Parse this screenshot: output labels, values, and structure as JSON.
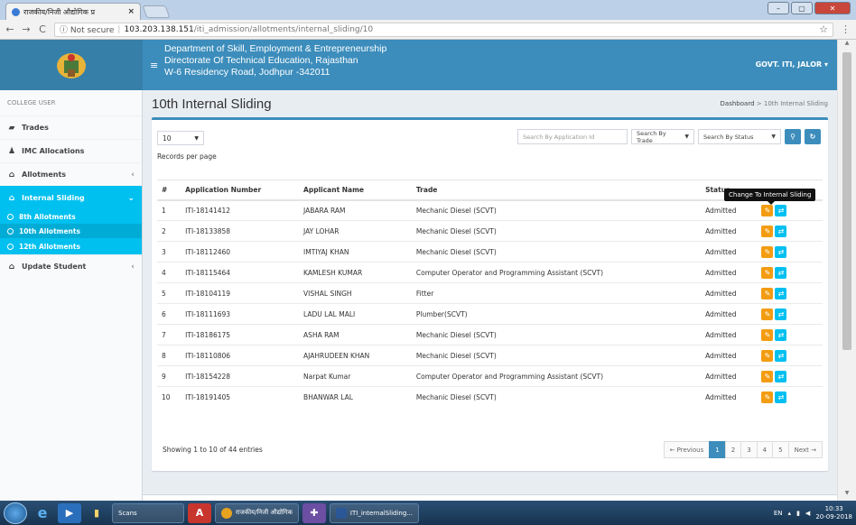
{
  "browser": {
    "tab_title": "राजकीय/निजी औद्योगिक प्र",
    "tab_close": "×",
    "secure_label": "ⓘ Not secure",
    "url_host": "103.203.138.151",
    "url_path": "/iti_admission/allotments/internal_sliding/10",
    "window_buttons": [
      "–",
      "▢",
      "✕"
    ]
  },
  "header": {
    "dept_line1": "Department of Skill, Employment & Entrepreneurship",
    "dept_line2": "Directorate Of Technical Education, Rajasthan",
    "dept_line3": "W-6 Residency Road, Jodhpur -342011",
    "user_menu": "GOVT. ITI, JALOR ▾"
  },
  "sidebar": {
    "header": "COLLEGE USER",
    "items": [
      {
        "label": "Trades",
        "icon": "book-icon"
      },
      {
        "label": "IMC Allocations",
        "icon": "user-icon"
      },
      {
        "label": "Allotments",
        "icon": "bank-icon"
      },
      {
        "label": "Internal Sliding",
        "icon": "bank-icon"
      },
      {
        "label": "Update Student",
        "icon": "bank-icon"
      }
    ],
    "subitems": [
      "8th Allotments",
      "10th Allotments",
      "12th Allotments"
    ]
  },
  "page": {
    "title": "10th Internal Sliding",
    "breadcrumb_home": "Dashboard",
    "breadcrumb_sep": ">",
    "breadcrumb_current": "10th Internal Sliding"
  },
  "controls": {
    "records_value": "10",
    "records_label": "Records per page",
    "search_app_placeholder": "Search By Application Id",
    "search_trade": "Search By Trade",
    "search_status": "Search By Status"
  },
  "table": {
    "headers": [
      "#",
      "Application Number",
      "Applicant Name",
      "Trade",
      "Status"
    ],
    "rows": [
      [
        "1",
        "ITI-18141412",
        "JABARA RAM",
        "Mechanic Diesel (SCVT)",
        "Admitted"
      ],
      [
        "2",
        "ITI-18133858",
        "JAY LOHAR",
        "Mechanic Diesel (SCVT)",
        "Admitted"
      ],
      [
        "3",
        "ITI-18112460",
        "IMTIYAJ KHAN",
        "Mechanic Diesel (SCVT)",
        "Admitted"
      ],
      [
        "4",
        "ITI-18115464",
        "KAMLESH KUMAR",
        "Computer Operator and Programming Assistant (SCVT)",
        "Admitted"
      ],
      [
        "5",
        "ITI-18104119",
        "VISHAL SINGH",
        "Fitter",
        "Admitted"
      ],
      [
        "6",
        "ITI-18111693",
        "LADU LAL MALI",
        "Plumber(SCVT)",
        "Admitted"
      ],
      [
        "7",
        "ITI-18186175",
        "ASHA RAM",
        "Mechanic Diesel (SCVT)",
        "Admitted"
      ],
      [
        "8",
        "ITI-18110806",
        "AJAHRUDEEN KHAN",
        "Mechanic Diesel (SCVT)",
        "Admitted"
      ],
      [
        "9",
        "ITI-18154228",
        "Narpat Kumar",
        "Computer Operator and Programming Assistant (SCVT)",
        "Admitted"
      ],
      [
        "10",
        "ITI-18191405",
        "BHANWAR LAL",
        "Mechanic Diesel (SCVT)",
        "Admitted"
      ]
    ],
    "tooltip": "Change To Internal Sliding"
  },
  "footer": {
    "showing": "Showing 1 to 10 of 44 entries",
    "pages": [
      "← Previous",
      "1",
      "2",
      "3",
      "4",
      "5",
      "Next →"
    ]
  },
  "taskbar": {
    "scans": "Scans",
    "chrome_task": "राजकीय/निजी औद्योगिक",
    "word_task": "ITI_internalSliding...",
    "lang": "EN",
    "time": "10:33",
    "date": "20-09-2018"
  },
  "colors": {
    "header_blue": "#3c8dbc",
    "sidebar_active": "#00c0ef",
    "edit_orange": "#f39c12",
    "slide_cyan": "#00c0ef"
  }
}
